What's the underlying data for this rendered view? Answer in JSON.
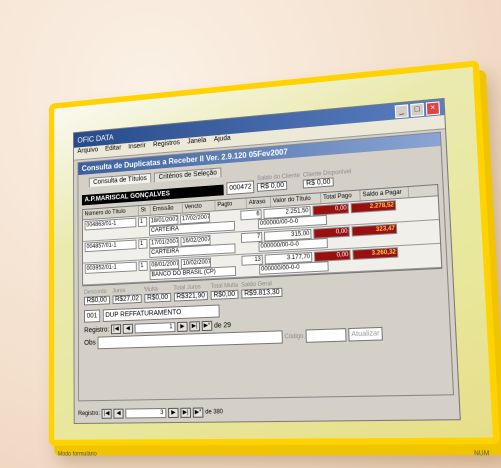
{
  "app": {
    "title": "Consulta de Duplicatas a Receber II  Ver. 2.9.120 05Fev2007",
    "window_title": "OFIC DATA"
  },
  "menu": [
    "Arquivo",
    "Editar",
    "Inserir",
    "Registros",
    "Janela",
    "Ajuda"
  ],
  "tabs": [
    "Consulta de Títulos",
    "Critérios de Seleção"
  ],
  "header": {
    "client": "A.P.MARISCAL GONÇALVES",
    "code": "000472",
    "total_label": "Saldo do Cliente",
    "total_value": "R$ 0,00",
    "total2_label": "Cliente Disponível",
    "total2_value": "R$ 0,00"
  },
  "columns": [
    "Número do Título",
    "St",
    "Emissão",
    "Vencto",
    "Pagto",
    "Atraso",
    "Valor do Título",
    "Total Pago",
    "Saldo a Pagar"
  ],
  "rows": [
    {
      "num": "004863/01-1",
      "st": "1",
      "emissao": "18/01/2007",
      "vencto": "17/02/2007",
      "atraso": "6",
      "valor": "2.251,50",
      "pago": "0,00",
      "saldo": "2.278,52",
      "banco": "CARTEIRA",
      "extra": "000000/00-0-0",
      "valor2": "315,00"
    },
    {
      "num": "004857/01-1",
      "st": "1",
      "emissao": "17/01/2007",
      "vencto": "16/02/2007",
      "atraso": "7",
      "valor": "315,00",
      "pago": "0,00",
      "saldo": "323,47",
      "banco": "CARTEIRA",
      "extra": "000000/00-0-0",
      "valor2": "3.177,70"
    },
    {
      "num": "003952/01-1",
      "st": "1",
      "emissao": "08/01/2007",
      "vencto": "10/02/2007",
      "atraso": "13",
      "valor": "3.177,70",
      "pago": "0,00",
      "saldo": "3.260,32",
      "banco": "BANCO DO BRASIL (CP)",
      "extra": "000000/00-0-0",
      "valor2": ""
    }
  ],
  "summary": {
    "desconto_label": "Desconto",
    "juros_label": "Juros",
    "multa_label": "Multa",
    "desconto": "R$0,00",
    "juros": "R$27,02",
    "multa": "R$0,00",
    "total_juros_label": "Total Juros",
    "total_juros": "R$321,90",
    "total_multa_label": "Total Multa",
    "total_multa": "R$0,00",
    "saldo_geral_label": "Saldo Geral",
    "saldo_geral": "R$9.813,30",
    "portador_code": "001",
    "portador": "DUP REFFATURAMENTO"
  },
  "nav_inner": {
    "label": "Registro:",
    "current": "1",
    "total": "de 29"
  },
  "obs_label": "Obs",
  "codigo_label": "Código",
  "atualizar_label": "Atualizar",
  "nav_outer": {
    "label": "Registro:",
    "current": "3",
    "total": "de 380"
  },
  "status_left": "Modo formulário",
  "status_right": "NUM"
}
